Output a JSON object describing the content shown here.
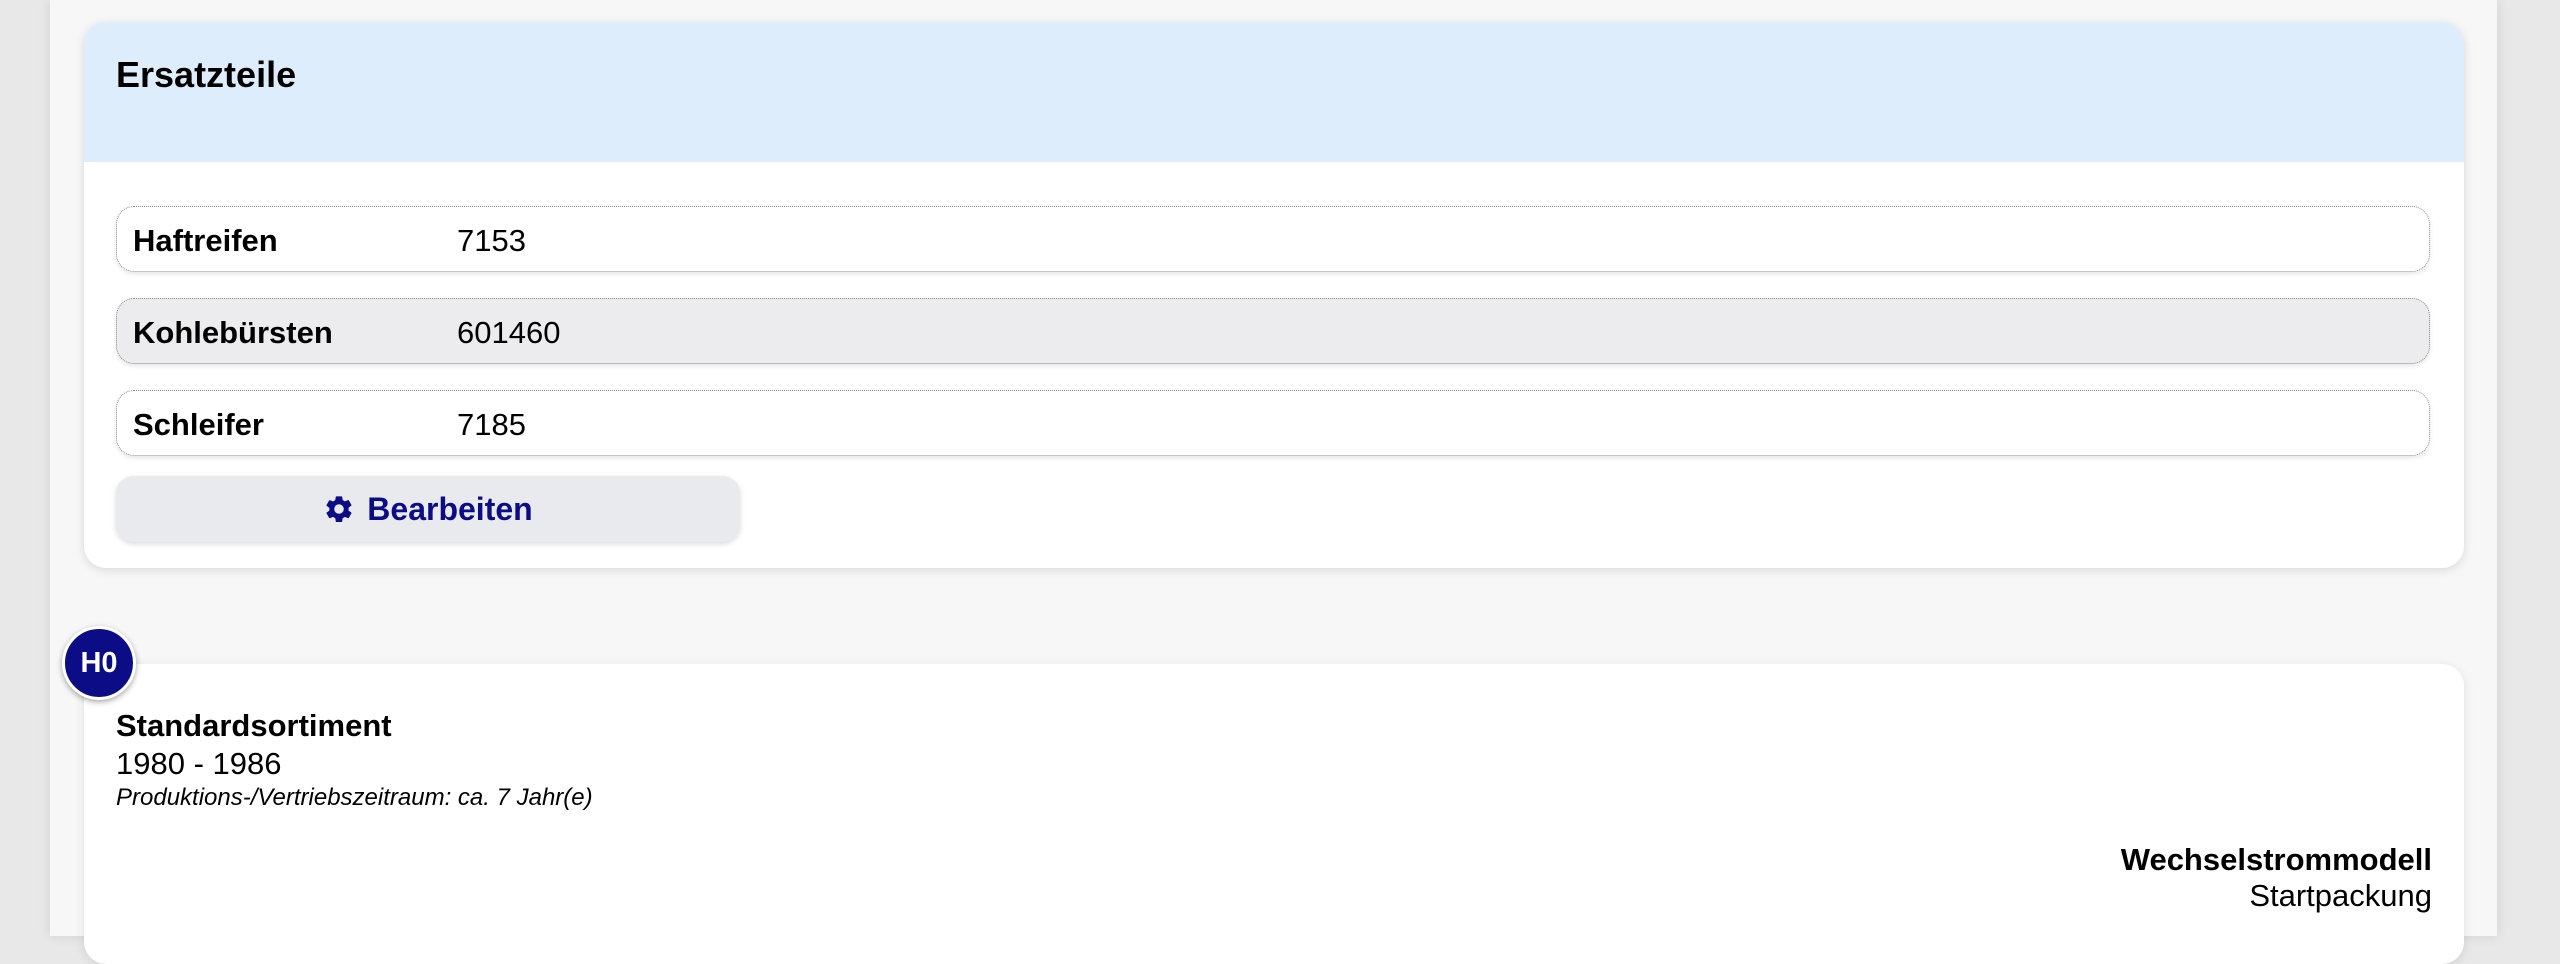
{
  "spare_parts": {
    "title": "Ersatzteile",
    "rows": [
      {
        "label": "Haftreifen",
        "value": "7153"
      },
      {
        "label": "Kohlebürsten",
        "value": "601460"
      },
      {
        "label": "Schleifer",
        "value": "7185"
      }
    ],
    "edit_label": "Bearbeiten",
    "edit_icon": "gear-icon"
  },
  "model": {
    "gauge": "H0",
    "range": "Standardsortiment",
    "years": "1980 - 1986",
    "period": "Produktions-/Vertriebszeitraum: ca. 7 Jahr(e)",
    "type": "Wechselstrommodell",
    "package": "Startpackung"
  },
  "colors": {
    "header_bg": "#deedfc",
    "accent": "#0c0c86",
    "alt_row": "#ececee"
  }
}
